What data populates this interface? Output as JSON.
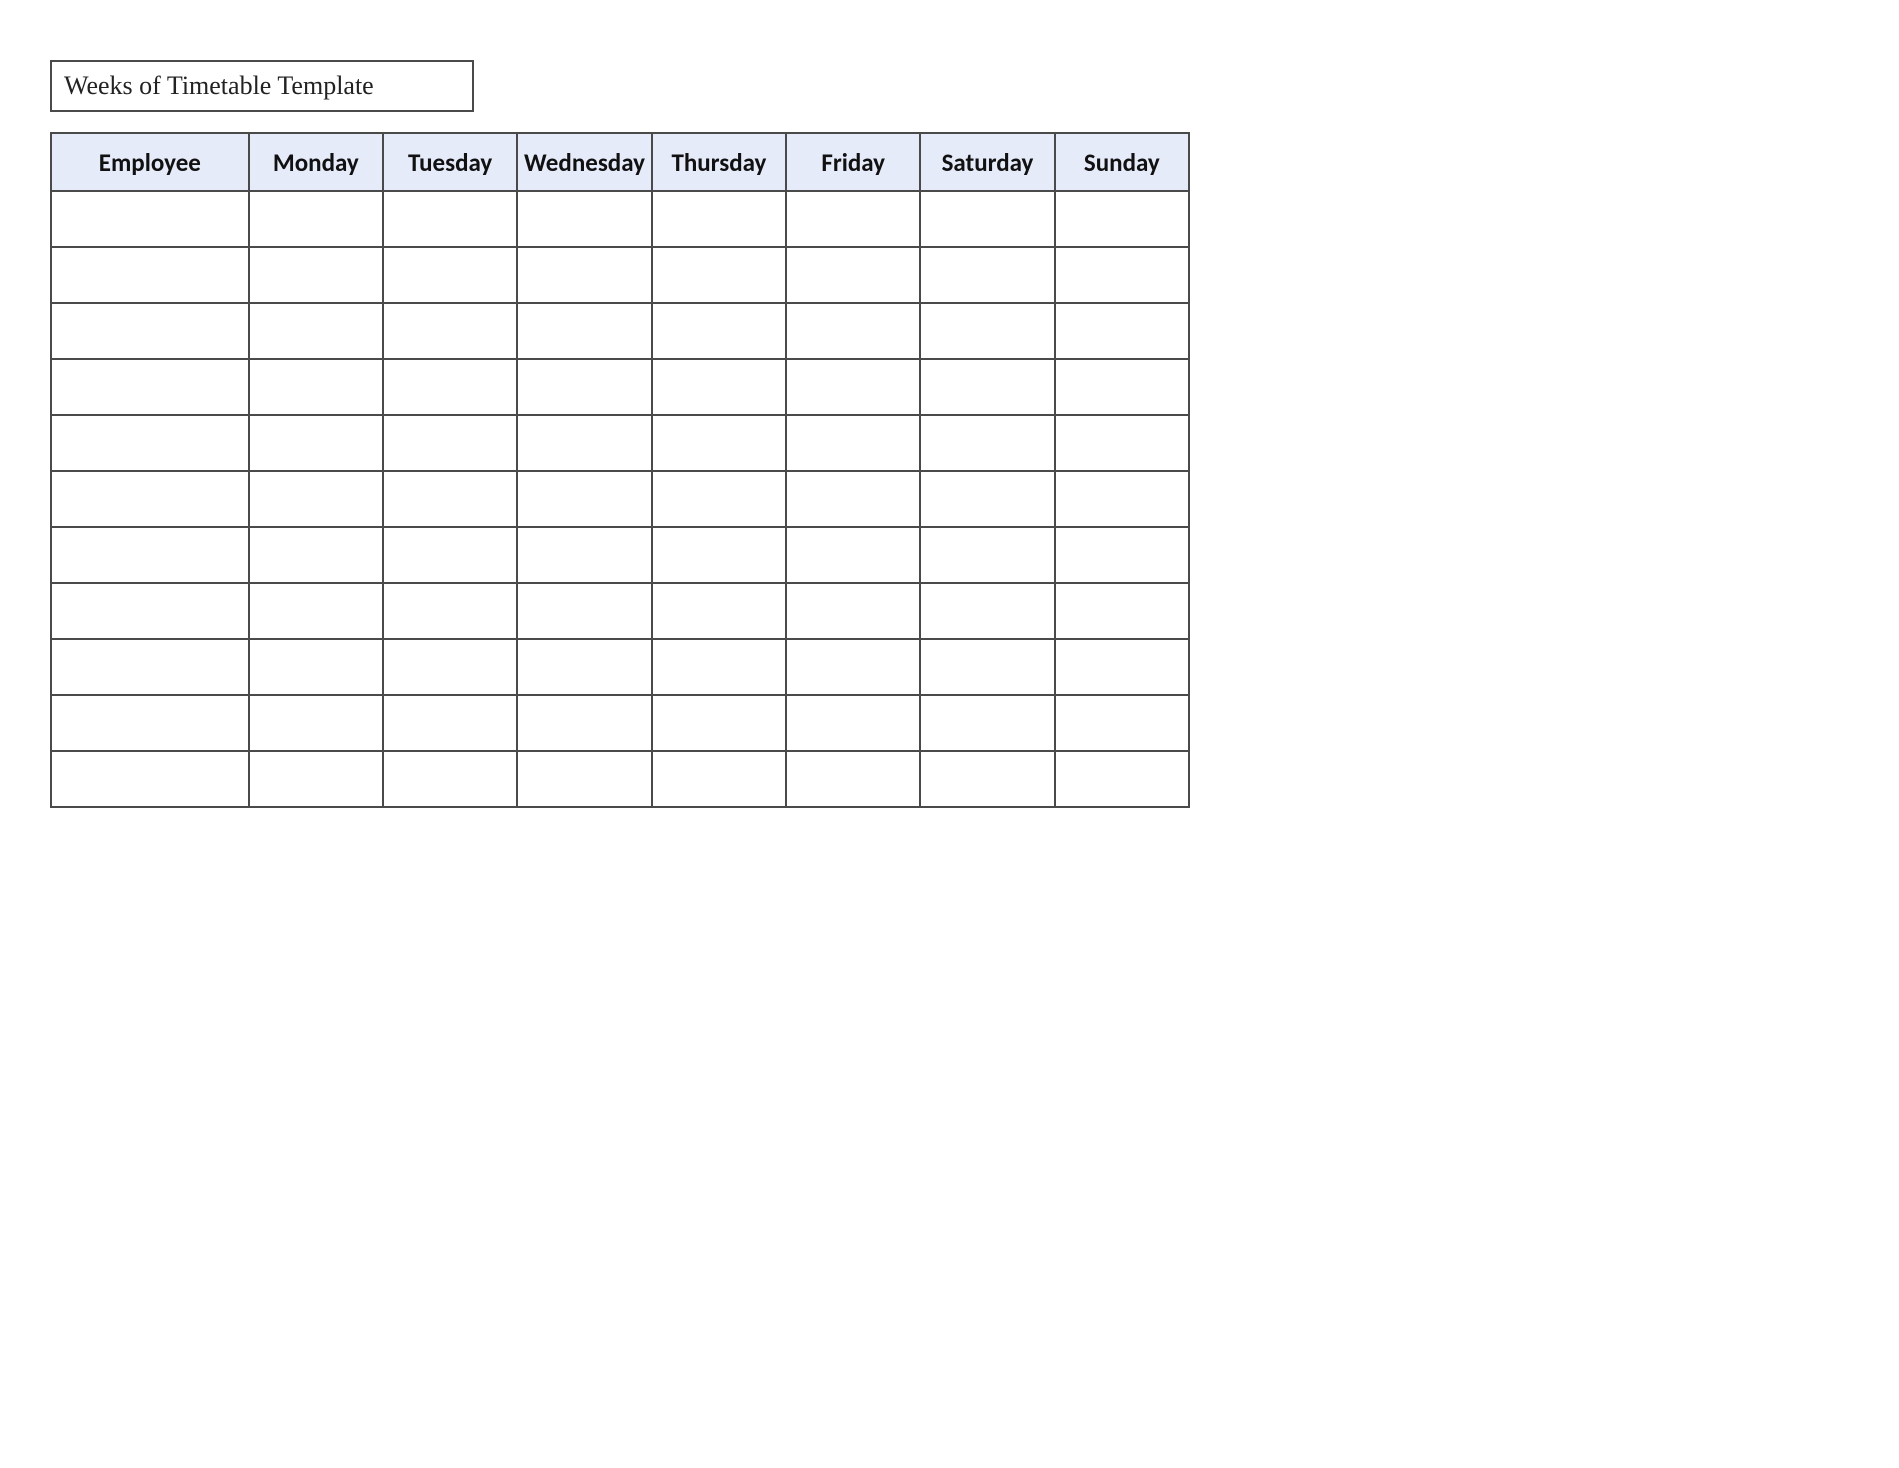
{
  "title": "Weeks of Timetable Template",
  "table": {
    "headers": [
      "Employee",
      "Monday",
      "Tuesday",
      "Wednesday",
      "Thursday",
      "Friday",
      "Saturday",
      "Sunday"
    ],
    "rows": [
      [
        "",
        "",
        "",
        "",
        "",
        "",
        "",
        ""
      ],
      [
        "",
        "",
        "",
        "",
        "",
        "",
        "",
        ""
      ],
      [
        "",
        "",
        "",
        "",
        "",
        "",
        "",
        ""
      ],
      [
        "",
        "",
        "",
        "",
        "",
        "",
        "",
        ""
      ],
      [
        "",
        "",
        "",
        "",
        "",
        "",
        "",
        ""
      ],
      [
        "",
        "",
        "",
        "",
        "",
        "",
        "",
        ""
      ],
      [
        "",
        "",
        "",
        "",
        "",
        "",
        "",
        ""
      ],
      [
        "",
        "",
        "",
        "",
        "",
        "",
        "",
        ""
      ],
      [
        "",
        "",
        "",
        "",
        "",
        "",
        "",
        ""
      ],
      [
        "",
        "",
        "",
        "",
        "",
        "",
        "",
        ""
      ],
      [
        "",
        "",
        "",
        "",
        "",
        "",
        "",
        ""
      ]
    ]
  }
}
